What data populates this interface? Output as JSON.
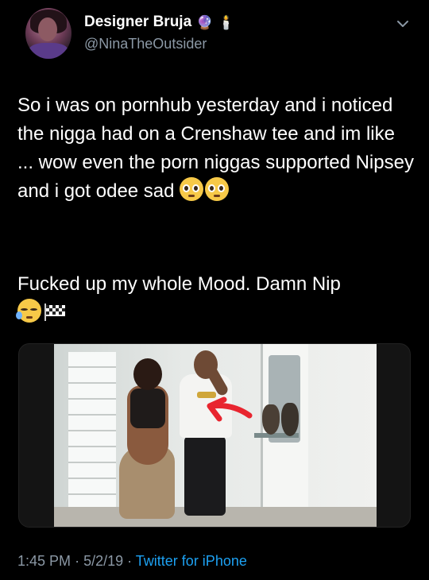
{
  "user": {
    "display_name": "Designer Bruja",
    "handle": "@NinaTheOutsider",
    "badges": [
      "crystal-ball-emoji",
      "candle-emoji"
    ]
  },
  "tweet": {
    "paragraph1": "So i was on pornhub yesterday and i noticed the nigga had on a Crenshaw tee and im like ... wow even the porn niggas supported Nipsey and i got odee sad",
    "paragraph1_emojis": [
      "pleading-face-emoji",
      "pleading-face-emoji"
    ],
    "paragraph2": "Fucked up my whole Mood. Damn Nip",
    "paragraph2_emojis": [
      "sleepy-face-emoji",
      "checkered-flag-emoji"
    ]
  },
  "media": {
    "type": "image",
    "description_marks": [
      "red-arrow-annotation"
    ],
    "arrow_color": "#e8252f"
  },
  "meta": {
    "time": "1:45 PM",
    "date": "5/2/19",
    "source": "Twitter for iPhone"
  },
  "colors": {
    "background": "#000000",
    "text_primary": "#ffffff",
    "text_secondary": "#8b98a5",
    "link": "#1da1f2"
  }
}
